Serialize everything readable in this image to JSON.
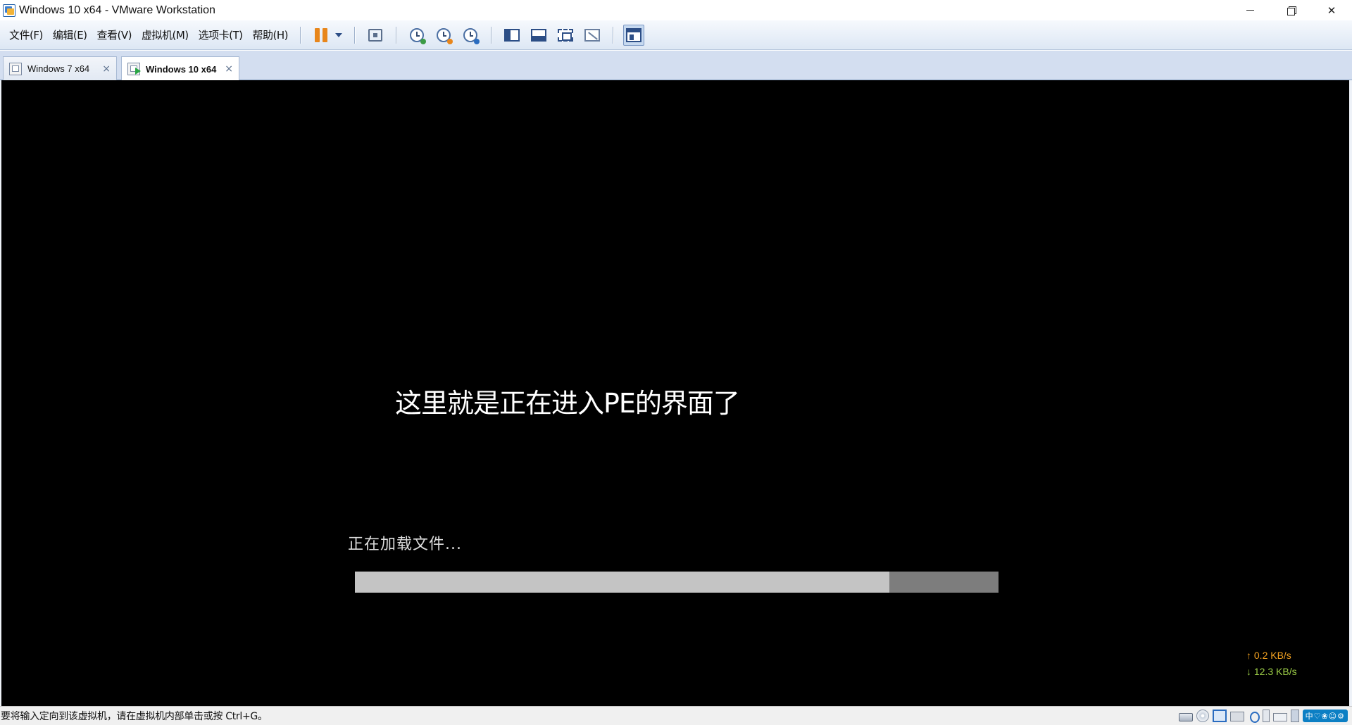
{
  "window": {
    "title": "Windows 10 x64 - VMware Workstation"
  },
  "menu": [
    {
      "label": "文件(F)"
    },
    {
      "label": "编辑(E)"
    },
    {
      "label": "查看(V)"
    },
    {
      "label": "虚拟机(M)"
    },
    {
      "label": "选项卡(T)"
    },
    {
      "label": "帮助(H)"
    }
  ],
  "toolbar_icons": [
    "pause-icon",
    "dropdown-icon",
    "send-ctrl-alt-del-icon",
    "snapshot-take-icon",
    "snapshot-revert-icon",
    "snapshot-manager-icon",
    "show-library-icon",
    "thumbnail-bar-icon",
    "full-screen-icon",
    "unity-icon",
    "console-view-icon"
  ],
  "tabs": [
    {
      "label": "Windows 7 x64",
      "active": false,
      "close": "×"
    },
    {
      "label": "Windows 10 x64",
      "active": true,
      "close": "×"
    }
  ],
  "console": {
    "message": "这里就是正在进入PE的界面了",
    "loading_text": "正在加载文件...",
    "progress_percent": 83,
    "net_up": "↑ 0.2 KB/s",
    "net_down": "↓ 12.3 KB/s"
  },
  "statusbar": {
    "hint": "要将输入定向到该虚拟机，请在虚拟机内部单击或按 Ctrl+G。",
    "ime": "中♡❀☺⚙"
  },
  "colors": {
    "console_bg": "#000000",
    "progress_fill": "#c4c4c4",
    "progress_track": "#7d7d7d",
    "net_up": "#f0a020",
    "net_down": "#9ed048"
  }
}
